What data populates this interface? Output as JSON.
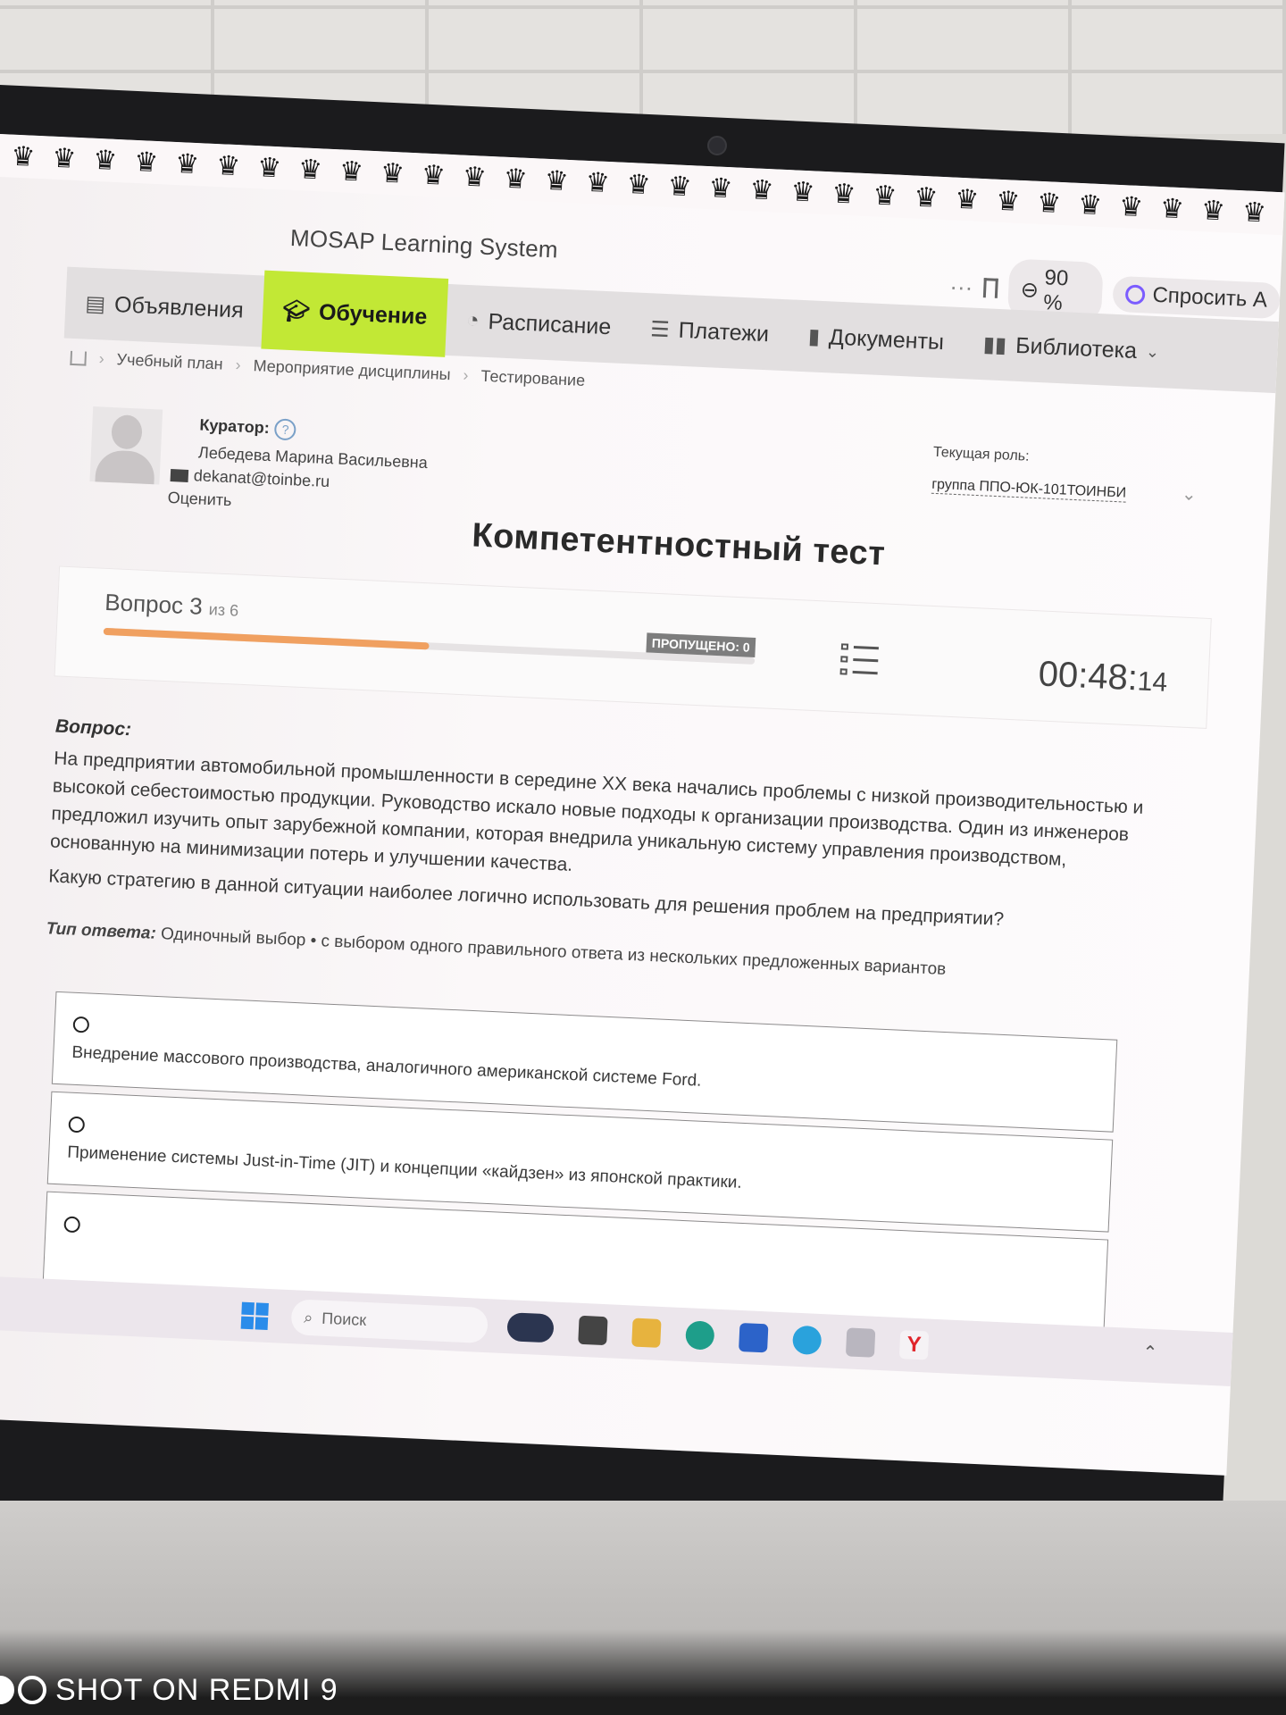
{
  "watermark": "SHOT ON REDMI 9",
  "app_title": "MOSAP Learning System",
  "toolbar": {
    "zoom": "90 %",
    "ask": "Спросить А"
  },
  "nav": {
    "items": [
      {
        "label": "Объявления",
        "icon": "announcements-icon"
      },
      {
        "label": "Обучение",
        "icon": "graduation-cap-icon",
        "active": true
      },
      {
        "label": "Расписание",
        "icon": "clock-icon"
      },
      {
        "label": "Платежи",
        "icon": "coins-icon"
      },
      {
        "label": "Документы",
        "icon": "document-icon"
      },
      {
        "label": "Библиотека",
        "icon": "book-icon"
      }
    ]
  },
  "breadcrumb": [
    "Учебный план",
    "Мероприятие дисциплины",
    "Тестирование"
  ],
  "curator": {
    "label": "Куратор:",
    "name": "Лебедева Марина Васильевна",
    "email": "dekanat@toinbe.ru",
    "rate": "Оценить"
  },
  "role": {
    "label": "Текущая роль:",
    "value": "группа ППО-ЮК-101ТОИНБИ"
  },
  "test": {
    "title": "Компетентностный тест",
    "question_prefix": "Вопрос 3",
    "question_total": "из 6",
    "progress": 0.5,
    "skipped": "ПРОПУЩЕНО: 0",
    "timer_main": "00:48:",
    "timer_sec": "14"
  },
  "question": {
    "label": "Вопрос:",
    "text": "На предприятии автомобильной промышленности в середине XX века начались проблемы с низкой производительностью и высокой себестоимостью продукции. Руководство искало новые подходы к организации производства. Один из инженеров предложил изучить опыт зарубежной компании, которая внедрила уникальную систему управления производством, основанную на минимизации потерь и улучшении качества.",
    "prompt": "Какую стратегию в данной ситуации наиболее логично использовать для решения проблем на предприятии?",
    "answer_type_label": "Тип ответа:",
    "answer_type_value": "Одиночный выбор • с выбором одного правильного ответа из нескольких предложенных вариантов"
  },
  "options": [
    "Внедрение массового производства, аналогичного американской системе Ford.",
    "Применение системы Just-in-Time (JIT) и концепции «кайдзен» из японской практики.",
    ""
  ],
  "taskbar": {
    "search_placeholder": "Поиск"
  }
}
